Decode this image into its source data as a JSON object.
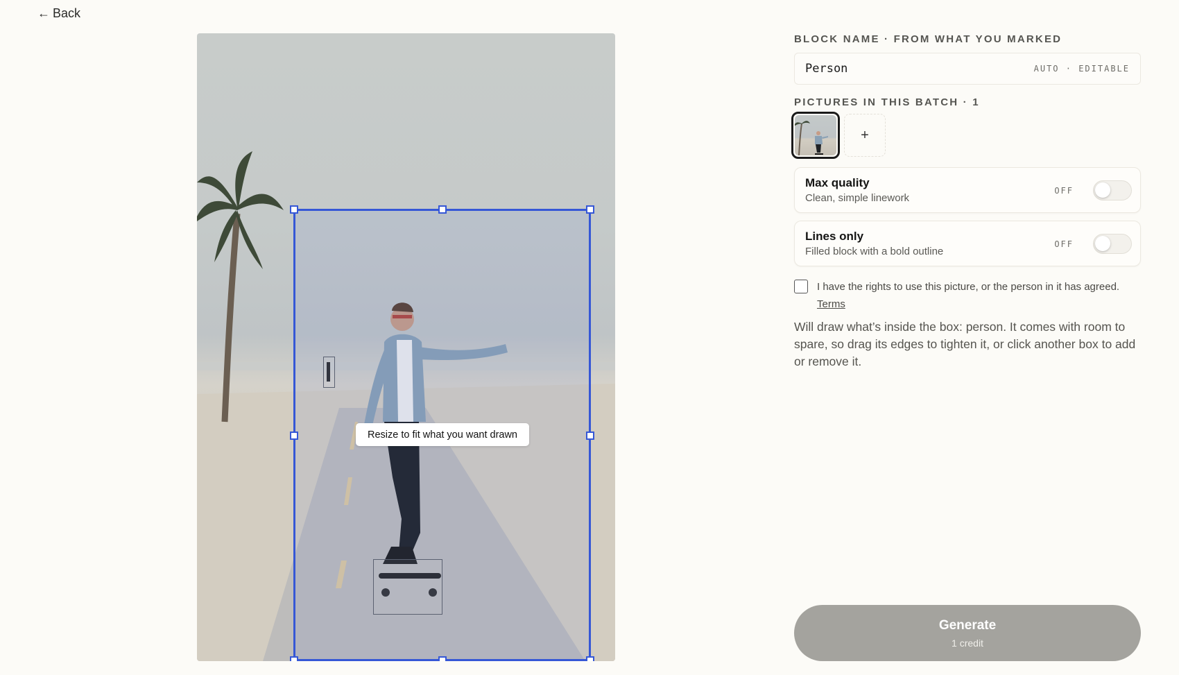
{
  "nav": {
    "back_label": "Back"
  },
  "canvas": {
    "tooltip": "Resize to fit what you want drawn"
  },
  "panel": {
    "block_name_label": "BLOCK NAME · FROM WHAT YOU MARKED",
    "block_name_value": "Person",
    "block_name_hint": "AUTO · EDITABLE",
    "pictures_label": "PICTURES IN THIS BATCH · 1",
    "add_picture_label": "+",
    "options": [
      {
        "title": "Max quality",
        "subtitle": "Clean, simple linework",
        "state": "OFF",
        "on": false
      },
      {
        "title": "Lines only",
        "subtitle": "Filled block with a bold outline",
        "state": "OFF",
        "on": false
      }
    ],
    "consent_text": "I have the rights to use this picture, or the person in it has agreed.",
    "terms_link": "Terms",
    "description": "Will draw what’s inside the box: person. It comes with room to spare, so drag its edges to tighten it, or click another box to add or remove it."
  },
  "generate": {
    "label": "Generate",
    "cost": "1 credit"
  },
  "colors": {
    "selection": "#3557d6",
    "generate_bg": "#a4a39e",
    "background": "#fcfbf7"
  }
}
